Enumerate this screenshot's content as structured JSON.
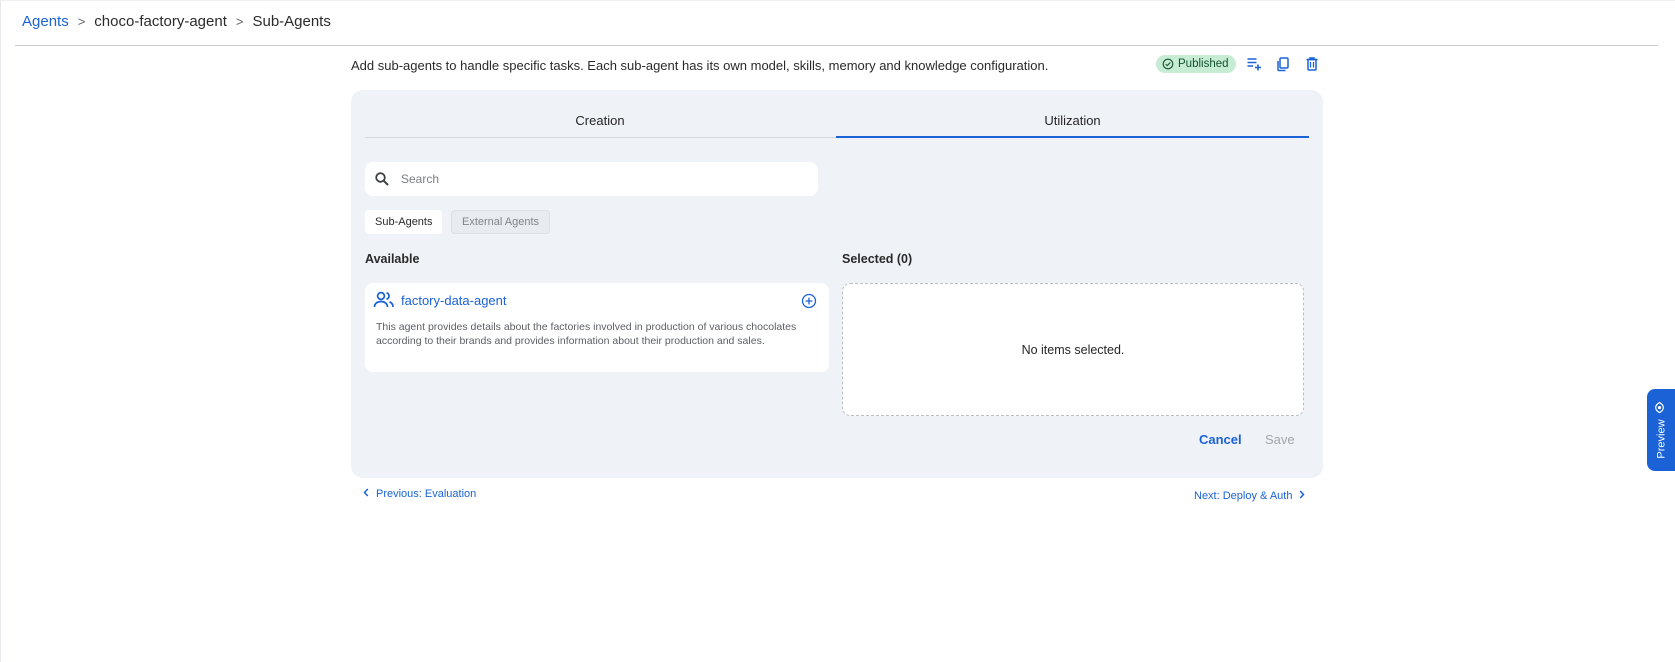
{
  "breadcrumb": {
    "root": "Agents",
    "separator": ">",
    "agent": "choco-factory-agent",
    "current": "Sub-Agents"
  },
  "header": {
    "description": "Add sub-agents to handle specific tasks. Each sub-agent has its own model, skills, memory and knowledge configuration.",
    "status": "Published",
    "status_color": "#c7ecd4",
    "icons": [
      "add-list-icon",
      "copy-icon",
      "delete-icon"
    ]
  },
  "tabs": [
    {
      "label": "Creation",
      "active": false
    },
    {
      "label": "Utilization",
      "active": true
    }
  ],
  "search": {
    "placeholder": "Search",
    "value": ""
  },
  "filters": [
    {
      "label": "Sub-Agents",
      "selected": true
    },
    {
      "label": "External Agents",
      "selected": false
    }
  ],
  "available": {
    "title": "Available",
    "items": [
      {
        "name": "factory-data-agent",
        "description": "This agent provides details about the factories involved in production of various chocolates according to their brands and provides information about their production and sales.",
        "icon": "people-icon"
      }
    ]
  },
  "selected": {
    "title": "Selected (0)",
    "empty_message": "No items selected."
  },
  "actions": {
    "cancel": "Cancel",
    "save": "Save"
  },
  "navigation": {
    "previous": "Previous: Evaluation",
    "next": "Next: Deploy & Auth"
  },
  "preview": {
    "label": "Preview"
  },
  "colors": {
    "accent": "#1a62d6",
    "card_bg": "#eff2f7"
  }
}
